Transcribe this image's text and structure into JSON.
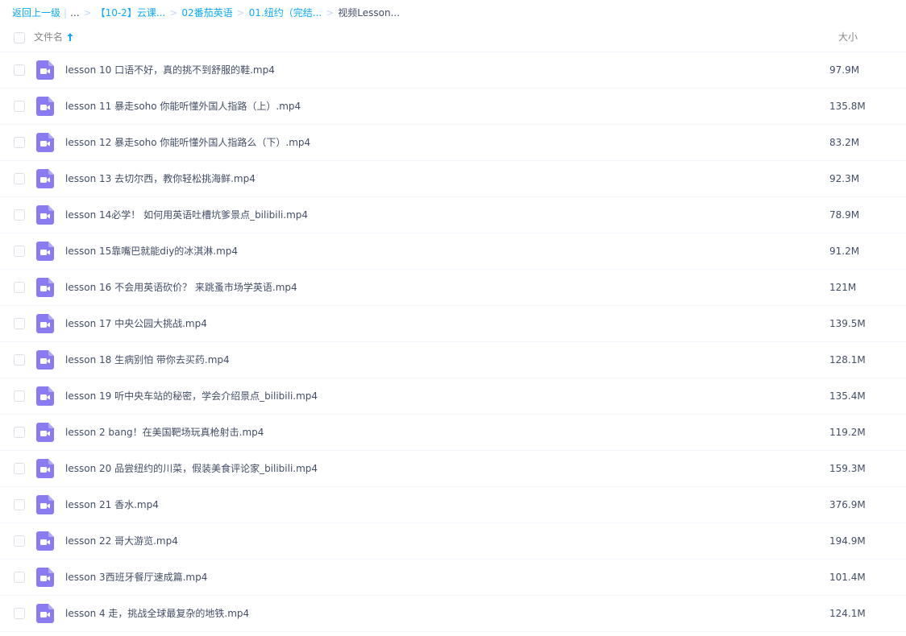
{
  "breadcrumb": {
    "back": "返回上一级",
    "ellipsis": "...",
    "crumbs": [
      "【10-2】云课...",
      "02番茄英语",
      "01.纽约（完结..."
    ],
    "current": "视频Lesson..."
  },
  "header": {
    "name_col": "文件名",
    "size_col": "大小",
    "sort_icon": "arrow-up-icon"
  },
  "colors": {
    "link": "#09aaff",
    "text": "#424e67",
    "icon": "#8a7cf0"
  },
  "files": [
    {
      "name": "lesson 10 口语不好，真的挑不到舒服的鞋.mp4",
      "size": "97.9M",
      "icon": "video-file-icon"
    },
    {
      "name": "lesson 11 暴走soho 你能听懂外国人指路（上）.mp4",
      "size": "135.8M",
      "icon": "video-file-icon"
    },
    {
      "name": "lesson 12 暴走soho 你能听懂外国人指路么（下）.mp4",
      "size": "83.2M",
      "icon": "video-file-icon"
    },
    {
      "name": "lesson 13 去切尔西，教你轻松挑海鲜.mp4",
      "size": "92.3M",
      "icon": "video-file-icon"
    },
    {
      "name": "lesson 14必学！ 如何用英语吐槽坑爹景点_bilibili.mp4",
      "size": "78.9M",
      "icon": "video-file-icon"
    },
    {
      "name": "lesson 15靠嘴巴就能diy的冰淇淋.mp4",
      "size": "91.2M",
      "icon": "video-file-icon"
    },
    {
      "name": "lesson 16 不会用英语砍价？ 来跳蚤市场学英语.mp4",
      "size": "121M",
      "icon": "video-file-icon"
    },
    {
      "name": "lesson 17 中央公园大挑战.mp4",
      "size": "139.5M",
      "icon": "video-file-icon"
    },
    {
      "name": "lesson 18 生病别怕 带你去买药.mp4",
      "size": "128.1M",
      "icon": "video-file-icon"
    },
    {
      "name": "lesson 19 听中央车站的秘密，学会介绍景点_bilibili.mp4",
      "size": "135.4M",
      "icon": "video-file-icon"
    },
    {
      "name": "lesson 2 bang！在美国靶场玩真枪射击.mp4",
      "size": "119.2M",
      "icon": "video-file-icon"
    },
    {
      "name": "lesson 20 品尝纽约的川菜，假装美食评论家_bilibili.mp4",
      "size": "159.3M",
      "icon": "video-file-icon"
    },
    {
      "name": "lesson 21 香水.mp4",
      "size": "376.9M",
      "icon": "video-file-icon"
    },
    {
      "name": "lesson 22 哥大游览.mp4",
      "size": "194.9M",
      "icon": "video-file-icon"
    },
    {
      "name": "lesson 3西班牙餐厅速成篇.mp4",
      "size": "101.4M",
      "icon": "video-file-icon"
    },
    {
      "name": "lesson 4 走，挑战全球最复杂的地铁.mp4",
      "size": "124.1M",
      "icon": "video-file-icon"
    }
  ]
}
